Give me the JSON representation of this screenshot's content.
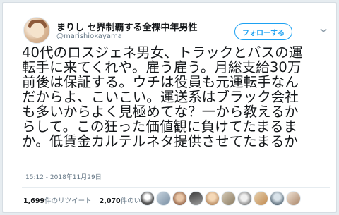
{
  "tweet": {
    "display_name": "まりし セ界制覇する全裸中年男性",
    "handle": "@marishiokayama",
    "follow_label": "フォローする",
    "text": "40代のロスジェネ男女、トラックとバスの運\n転手に来てくれや。雇う雇う。月総支給30万\n前後は保証する。ウチは役員も元運転手なん\nだからよ、こいこい。運送系はブラック会社\nも多いからよく見極めてな？一から教えるか\nらして。この狂った価値観に負けてたまるま\nか。低賃金カルテルネタ提供させてたまるか",
    "timestamp": "15:12 - 2018年11月29日",
    "retweets_count": "1,699",
    "retweets_label": "件のリツイート",
    "likes_count": "2,070",
    "likes_label": "件のいいね"
  },
  "icons": {
    "caret": "chevron-down-icon",
    "avatar": "profile-avatar"
  },
  "colors": {
    "accent": "#1da1f2",
    "secondary_text": "#657786"
  }
}
